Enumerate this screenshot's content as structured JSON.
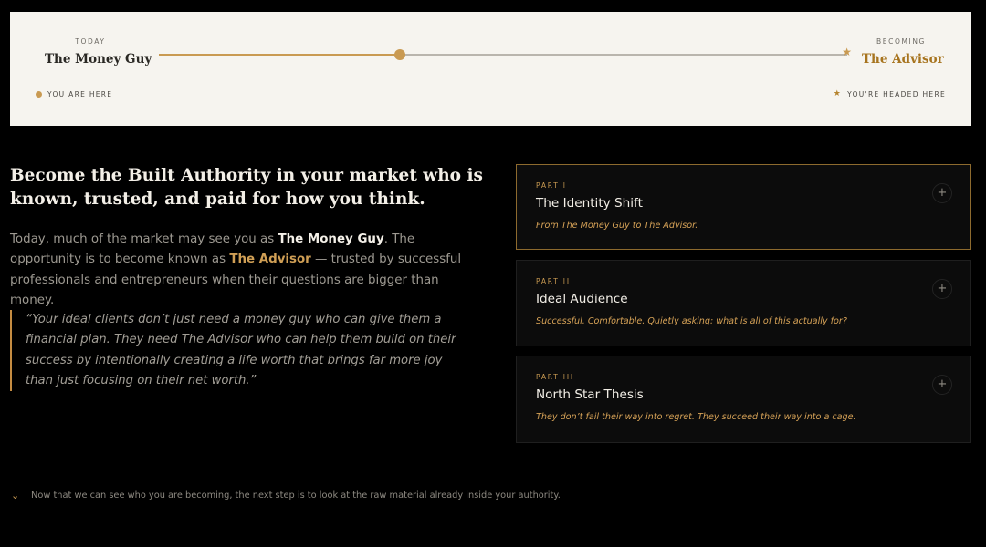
{
  "journey": {
    "today_kicker": "TODAY",
    "today_name": "The Money Guy",
    "today_marker": "YOU ARE HERE",
    "becoming_kicker": "BECOMING",
    "becoming_name": "The Advisor",
    "becoming_marker": "YOU'RE HEADED HERE",
    "progress": 0.35,
    "accent": "#c99a52"
  },
  "main": {
    "headline": "Become the Built Authority in your market who is known, trusted, and paid for how you think.",
    "intro_1": "Today, much of the market may see you as ",
    "intro_hl_1": "The Money Guy",
    "intro_2": ". The opportunity is to become known as ",
    "intro_hl_2": "The Advisor",
    "intro_3": " — trusted by successful professionals and entrepreneurs when their questions are bigger than money.",
    "quote": "“Your ideal clients don’t just need a money guy who can give them a financial plan. They need The Advisor who can help them build on their success by intentionally creating a life worth that brings far more joy than just focusing on their net worth.”"
  },
  "parts": [
    {
      "kicker": "PART I",
      "title": "The Identity Shift",
      "subtitle": "From The Money Guy to The Advisor.",
      "icon": "+"
    },
    {
      "kicker": "PART II",
      "title": "Ideal Audience",
      "subtitle": "Successful. Comfortable. Quietly asking: what is all of this actually for?",
      "icon": "+"
    },
    {
      "kicker": "PART III",
      "title": "North Star Thesis",
      "subtitle": "They don’t fail their way into regret. They succeed their way into a cage.",
      "icon": "+"
    }
  ],
  "footer": {
    "icon": "⌄",
    "text": "Now that we can see who you are becoming, the next step is to look at the raw material already inside your authority."
  }
}
